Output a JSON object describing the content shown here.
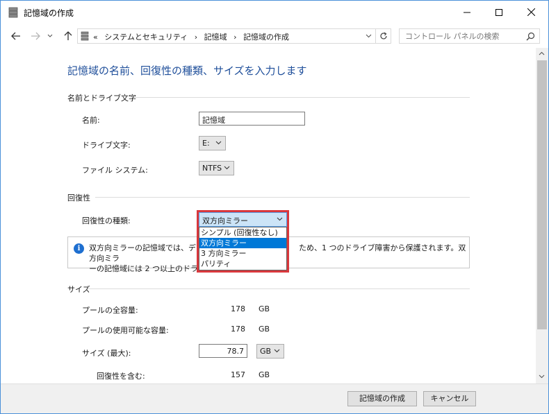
{
  "window": {
    "title": "記憶域の作成",
    "minimize_icon": "minimize-icon",
    "maximize_icon": "maximize-icon",
    "close_icon": "close-icon"
  },
  "address_bar": {
    "breadcrumb_prefix": "«",
    "breadcrumbs": [
      "システムとセキュリティ",
      "記憶域",
      "記憶域の作成"
    ],
    "separator": "›",
    "search_placeholder": "コントロール パネルの検索"
  },
  "main": {
    "heading": "記憶域の名前、回復性の種類、サイズを入力します",
    "name_section": {
      "title": "名前とドライブ文字",
      "name_label": "名前:",
      "name_value": "記憶域",
      "drive_label": "ドライブ文字:",
      "drive_value": "E:",
      "fs_label": "ファイル システム:",
      "fs_value": "NTFS"
    },
    "resiliency_section": {
      "title": "回復性",
      "type_label": "回復性の種類:",
      "type_value": "双方向ミラー",
      "options": [
        "シンプル (回復性なし)",
        "双方向ミラー",
        "3 方向ミラー",
        "パリティ"
      ],
      "selected_index": 1,
      "info_line1": "双方向ミラーの記憶域では、データ",
      "info_line1_tail": "ため、1 つのドライブ障害から保護されます。双方向ミラ",
      "info_line2": "ーの記憶域には 2 つ以上のドライブ"
    },
    "size_section": {
      "title": "サイズ",
      "total_label": "プールの全容量:",
      "total_value": "178",
      "total_unit": "GB",
      "available_label": "プールの使用可能な容量:",
      "available_value": "178",
      "available_unit": "GB",
      "max_label": "サイズ (最大):",
      "max_value": "78.7",
      "max_unit": "GB",
      "incl_label": "回復性を含む:",
      "incl_value": "157",
      "incl_unit": "GB"
    }
  },
  "footer": {
    "create_button": "記憶域の作成",
    "cancel_button": "キャンセル"
  },
  "colors": {
    "heading": "#1e4e9a",
    "selection": "#0078d7",
    "highlight_border": "#d9383d"
  }
}
